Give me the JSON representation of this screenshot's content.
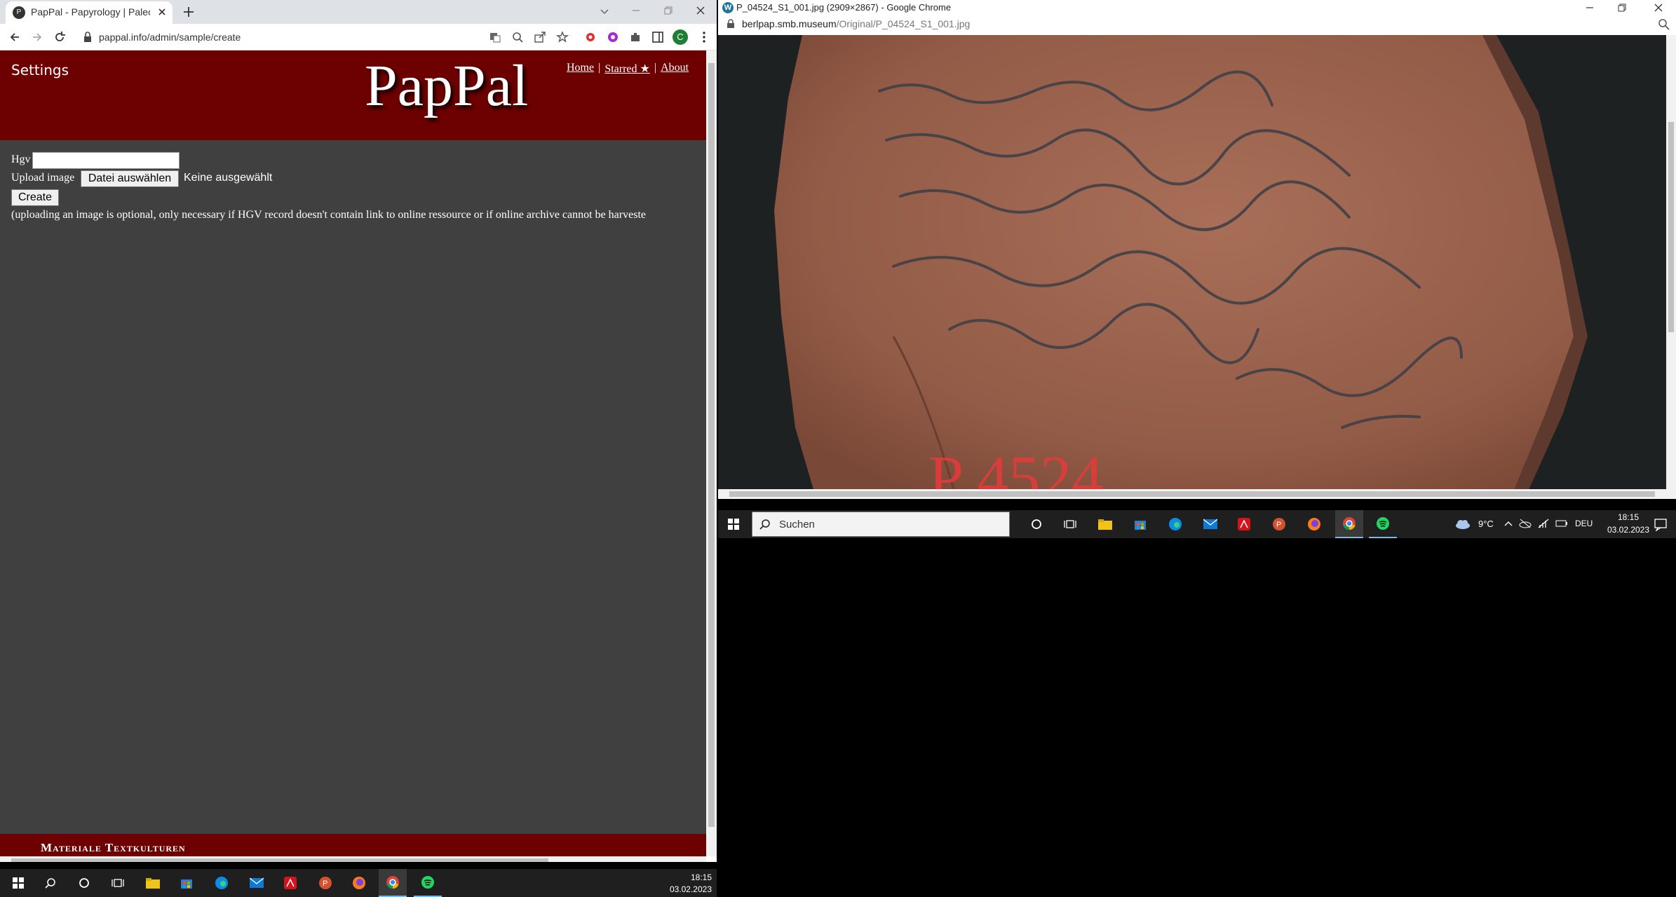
{
  "left_window": {
    "tab_title": "PapPal - Papyrology | Paleograph",
    "favicon_letter": "P",
    "url": "pappal.info/admin/sample/create",
    "profile_initial": "C"
  },
  "page": {
    "settings_label": "Settings",
    "logo": "PapPal",
    "nav": {
      "home": "Home",
      "starred": "Starred ★",
      "about": "About"
    },
    "sep": "|",
    "hgv_label": "Hgv",
    "upload_label": "Upload image",
    "file_button": "Datei auswählen",
    "file_status": "Keine ausgewählt",
    "create_button": "Create",
    "note": "(uploading an image is optional, only necessary if HGV record doesn't contain link to online ressource or if online archive cannot be harveste",
    "footer_text": "Materiale Textkulturen"
  },
  "right_window": {
    "title": "P_04524_S1_001.jpg (2909×2867) - Google Chrome",
    "url_host": "berlpap.smb.museum",
    "url_path": "/Original/P_04524_S1_001.jpg"
  },
  "taskbar_left": {
    "time": "18:15",
    "date": "03.02.2023"
  },
  "taskbar_right": {
    "search_placeholder": "Suchen",
    "weather": "9°C",
    "lang": "DEU",
    "time": "18:15",
    "date": "03.02.2023"
  },
  "colors": {
    "header": "#6d0000",
    "page_bg": "#404040",
    "taskbar": "#1f1f1f"
  }
}
